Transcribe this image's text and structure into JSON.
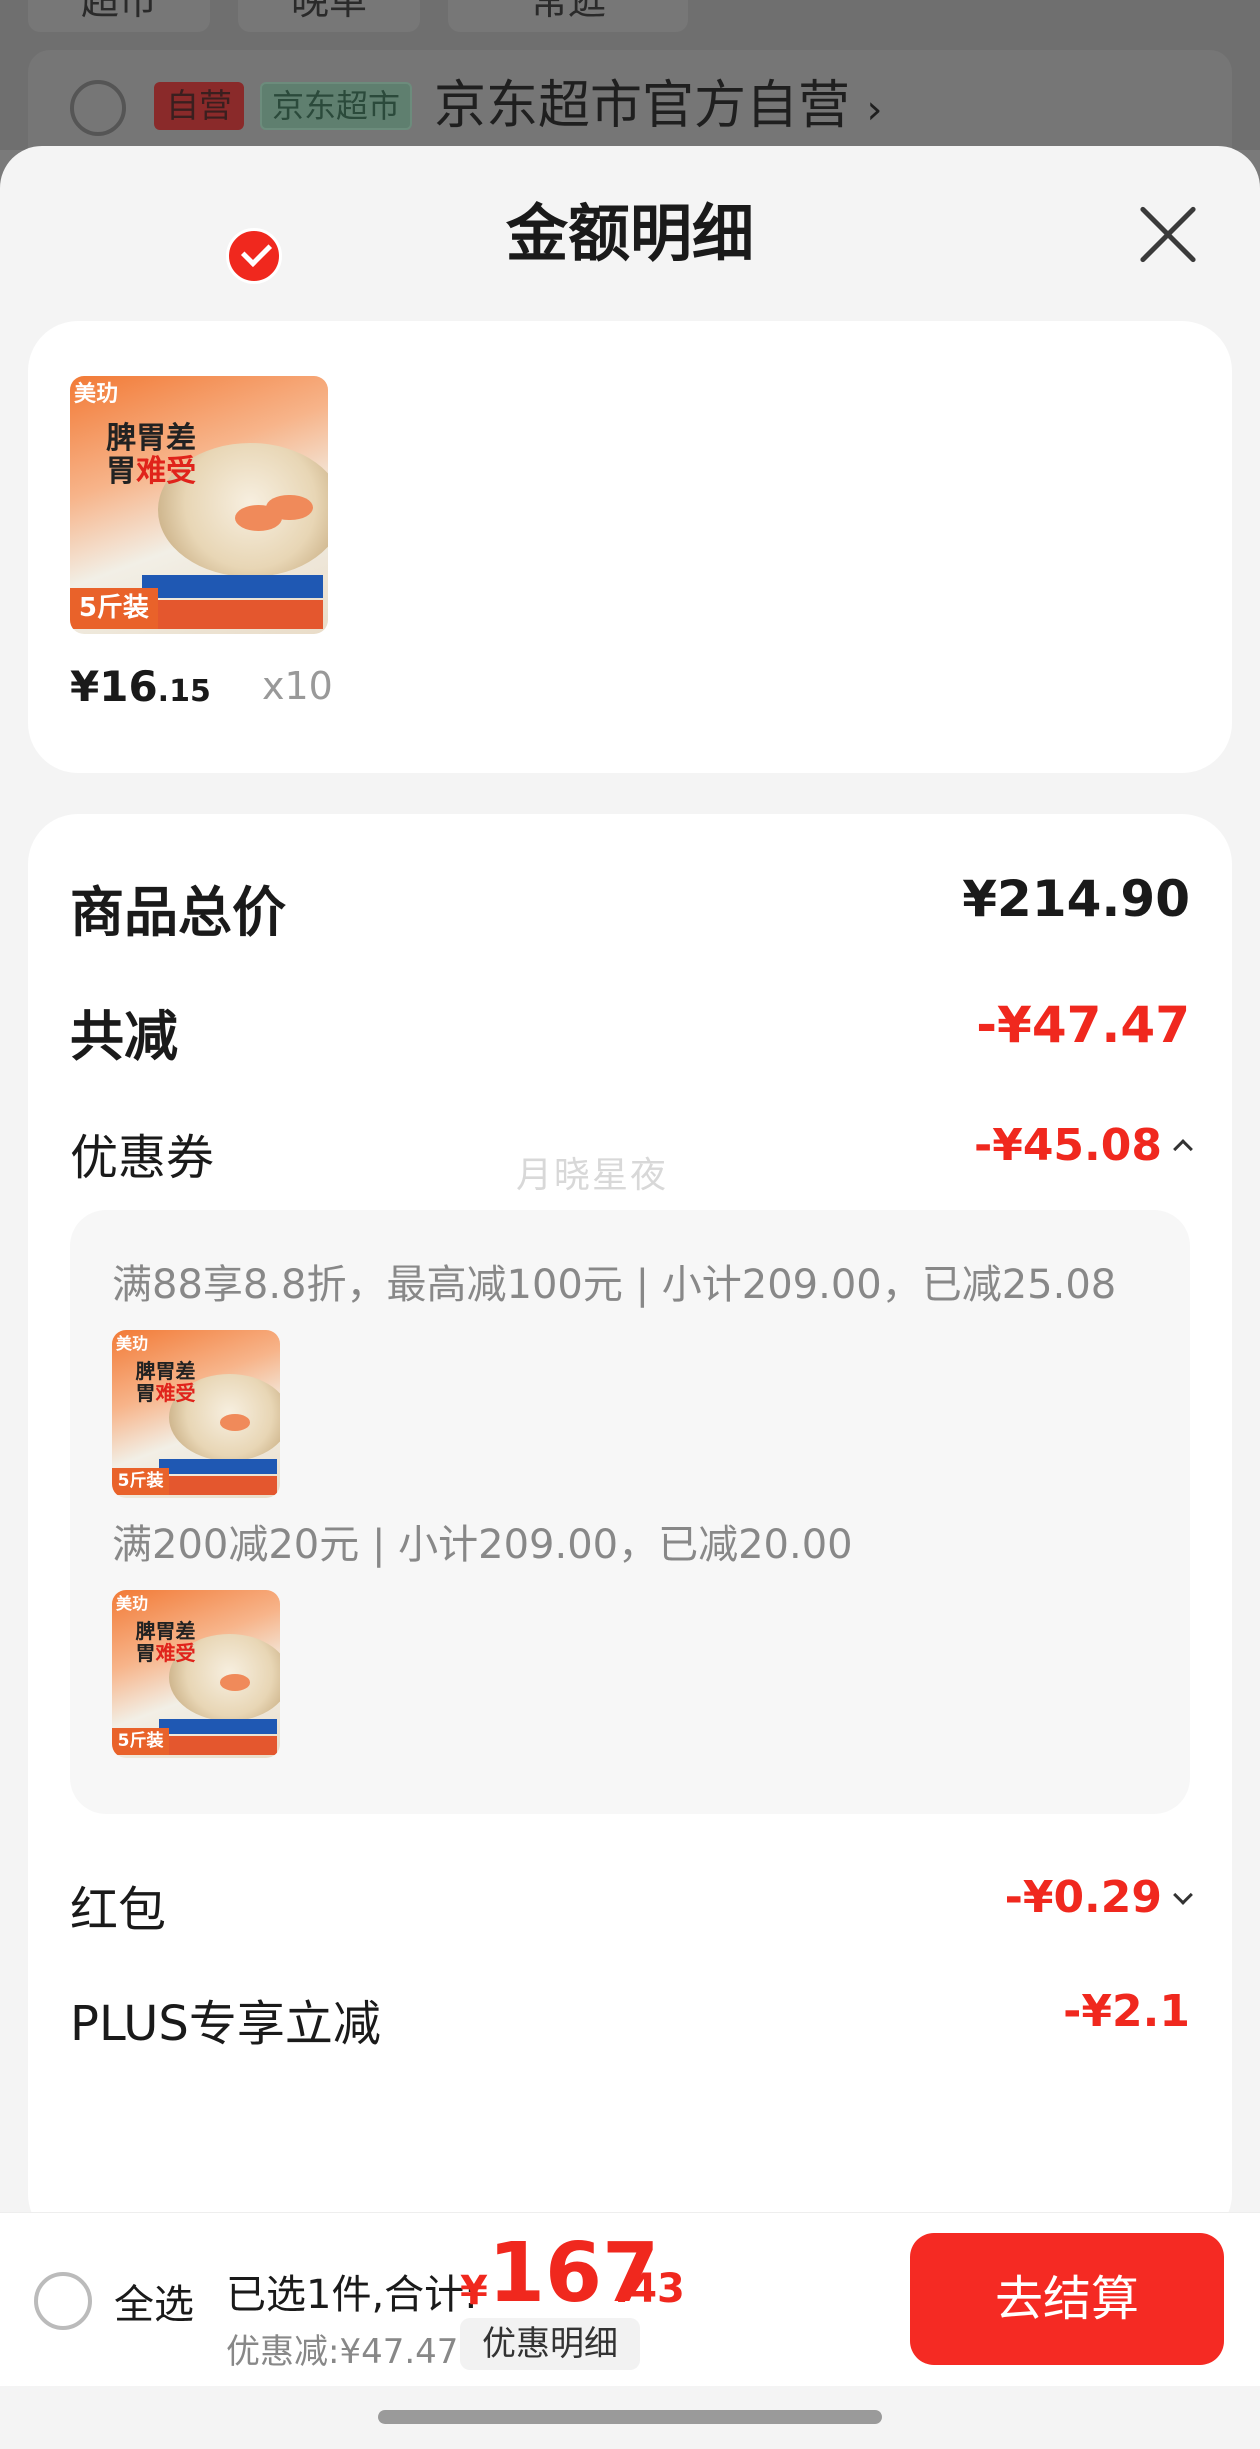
{
  "background": {
    "tabs": [
      "超市",
      "晚单",
      "常逛"
    ],
    "store": {
      "tag_self": "自营",
      "tag_market": "京东超市",
      "name": "京东超市官方自营",
      "arrow": "›"
    }
  },
  "sheet": {
    "title": "金额明细",
    "close_icon": "close-icon"
  },
  "item": {
    "price_int": "¥16",
    "price_dec": ".15",
    "qty": "x10",
    "thumb": {
      "brand": "美玏",
      "line1": "脾胃差",
      "line2a": "胃",
      "line2b": "难受",
      "pack": "5斤装"
    }
  },
  "breakdown": {
    "total_label": "商品总价",
    "total_value": "¥214.90",
    "reduce_label": "共减",
    "reduce_value": "-¥47.47",
    "coupon_label": "优惠券",
    "coupon_value": "-¥45.08",
    "coupon_rules": [
      "满88享8.8折，最高减100元 | 小计209.00，已减25.08",
      "满200减20元 | 小计209.00，已减20.00"
    ],
    "redpacket_label": "红包",
    "redpacket_value": "-¥0.29",
    "plus_label": "PLUS专享立减",
    "plus_value": "-¥2.1",
    "watermark": "月晓星夜"
  },
  "bottom": {
    "select_all": "全选",
    "summary_label": "已选1件,合计:",
    "yen": "¥",
    "total_int": "167",
    "total_dec": ".43",
    "discount_label": "优惠减:¥47.47",
    "detail_button": "优惠明细",
    "checkout_button": "去结算"
  },
  "colors": {
    "accent": "#f0281e",
    "checkout": "#f52a23"
  }
}
